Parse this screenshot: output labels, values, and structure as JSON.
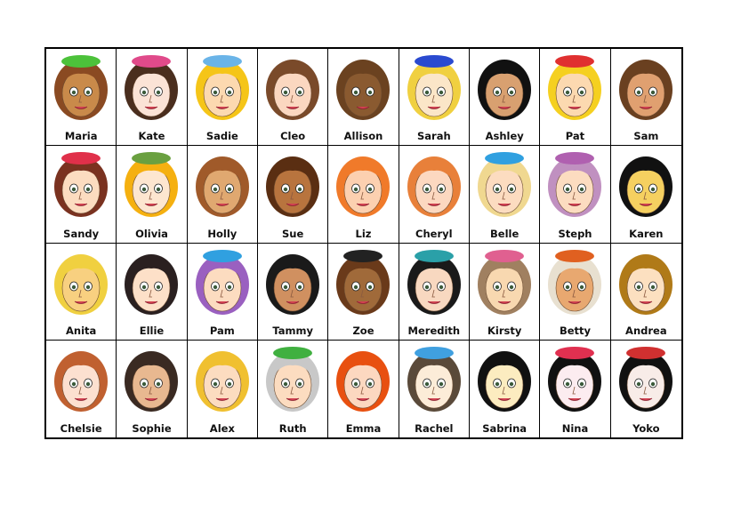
{
  "characters": [
    {
      "name": "Maria",
      "hair": "#8a4a22",
      "skin": "#c98a4a",
      "accent": "#4cc23a"
    },
    {
      "name": "Kate",
      "hair": "#4a2e1e",
      "skin": "#fbe3d6",
      "accent": "#e04a8a"
    },
    {
      "name": "Sadie",
      "hair": "#f5c518",
      "skin": "#fcd9b0",
      "accent": "#6ab4e8"
    },
    {
      "name": "Cleo",
      "hair": "#7a4a2a",
      "skin": "#fbd7c0",
      "accent": ""
    },
    {
      "name": "Allison",
      "hair": "#6b4220",
      "skin": "#8a5a30",
      "accent": ""
    },
    {
      "name": "Sarah",
      "hair": "#f0d040",
      "skin": "#fbe6c8",
      "accent": "#2a4ad0"
    },
    {
      "name": "Ashley",
      "hair": "#111111",
      "skin": "#d8a070",
      "accent": ""
    },
    {
      "name": "Pat",
      "hair": "#f5d020",
      "skin": "#fcd9b0",
      "accent": "#e03030"
    },
    {
      "name": "Sam",
      "hair": "#6a4020",
      "skin": "#e0a070",
      "accent": ""
    },
    {
      "name": "Sandy",
      "hair": "#7a3220",
      "skin": "#fcdcc0",
      "accent": "#e0304a"
    },
    {
      "name": "Olivia",
      "hair": "#f5b010",
      "skin": "#fde6d0",
      "accent": "#6aa040"
    },
    {
      "name": "Holly",
      "hair": "#a05a2a",
      "skin": "#e0a870",
      "accent": ""
    },
    {
      "name": "Sue",
      "hair": "#5a2e12",
      "skin": "#b8743e",
      "accent": ""
    },
    {
      "name": "Liz",
      "hair": "#f07a2a",
      "skin": "#fcd0b0",
      "accent": ""
    },
    {
      "name": "Cheryl",
      "hair": "#e8803a",
      "skin": "#fcd8c0",
      "accent": ""
    },
    {
      "name": "Belle",
      "hair": "#f0d890",
      "skin": "#fcdcc0",
      "accent": "#30a0e0"
    },
    {
      "name": "Steph",
      "hair": "#c090c0",
      "skin": "#fcdcc0",
      "accent": "#b060b0"
    },
    {
      "name": "Karen",
      "hair": "#111111",
      "skin": "#f5d060",
      "accent": ""
    },
    {
      "name": "Anita",
      "hair": "#f0d040",
      "skin": "#f8d080",
      "accent": ""
    },
    {
      "name": "Ellie",
      "hair": "#2a2020",
      "skin": "#fde0c8",
      "accent": ""
    },
    {
      "name": "Pam",
      "hair": "#9a60c0",
      "skin": "#fcdcc0",
      "accent": "#30a0e0"
    },
    {
      "name": "Tammy",
      "hair": "#1a1a1a",
      "skin": "#d09060",
      "accent": ""
    },
    {
      "name": "Zoe",
      "hair": "#6a3a1a",
      "skin": "#a06a3a",
      "accent": "#222222"
    },
    {
      "name": "Meredith",
      "hair": "#1a1a1a",
      "skin": "#f8d8c0",
      "accent": "#2aa0a8"
    },
    {
      "name": "Kirsty",
      "hair": "#a08060",
      "skin": "#f8d8b0",
      "accent": "#e06090"
    },
    {
      "name": "Betty",
      "hair": "#e8e0d0",
      "skin": "#e8a870",
      "accent": "#e06020"
    },
    {
      "name": "Andrea",
      "hair": "#b07a18",
      "skin": "#fce0c0",
      "accent": ""
    },
    {
      "name": "Chelsie",
      "hair": "#c06030",
      "skin": "#fce0d0",
      "accent": ""
    },
    {
      "name": "Sophie",
      "hair": "#3a2a22",
      "skin": "#e8b890",
      "accent": ""
    },
    {
      "name": "Alex",
      "hair": "#f0c030",
      "skin": "#fcdcc0",
      "accent": ""
    },
    {
      "name": "Ruth",
      "hair": "#c8c8c8",
      "skin": "#fcdcc0",
      "accent": "#40b040"
    },
    {
      "name": "Emma",
      "hair": "#e85010",
      "skin": "#fcd8c0",
      "accent": ""
    },
    {
      "name": "Rachel",
      "hair": "#5a4a3a",
      "skin": "#fcecd8",
      "accent": "#40a0e0"
    },
    {
      "name": "Sabrina",
      "hair": "#111111",
      "skin": "#fcecc0",
      "accent": ""
    },
    {
      "name": "Nina",
      "hair": "#111111",
      "skin": "#fcecf0",
      "accent": "#e03050"
    },
    {
      "name": "Yoko",
      "hair": "#111111",
      "skin": "#f8ece8",
      "accent": "#d03030"
    }
  ]
}
